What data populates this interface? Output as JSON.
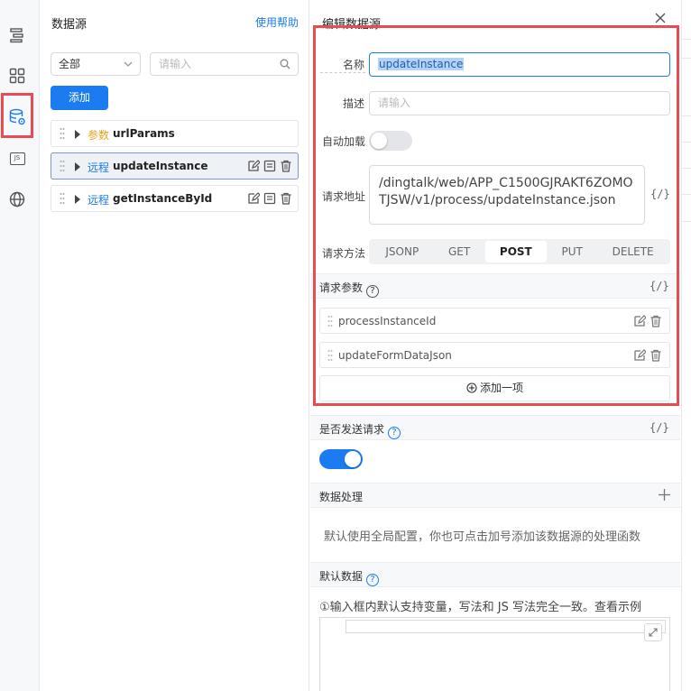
{
  "rail": {
    "icons": [
      "outline-tree-icon",
      "components-grid-icon",
      "datasource-icon",
      "js-icon",
      "globe-icon"
    ],
    "js_label": "JS"
  },
  "datasource_panel": {
    "title": "数据源",
    "help_link": "使用帮助",
    "filter_select": "全部",
    "search_placeholder": "请输入",
    "add_button": "添加",
    "items": [
      {
        "tag": "参数",
        "name": "urlParams",
        "tag_color": "#e8a020"
      },
      {
        "tag": "远程",
        "name": "updateInstance",
        "tag_color": "#1a7cf0",
        "selected": true
      },
      {
        "tag": "远程",
        "name": "getInstanceById",
        "tag_color": "#1a7cf0"
      }
    ]
  },
  "editor": {
    "title": "编辑数据源",
    "name_label": "名称",
    "name_value": "updateInstance",
    "desc_label": "描述",
    "desc_placeholder": "请输入",
    "autoload_label": "自动加载",
    "autoload_on": false,
    "url_label": "请求地址",
    "url_value": "/dingtalk/web/APP_C1500GJRAKT6ZOMOTJSW/v1/process/updateInstance.json",
    "braces": "{/}",
    "method_label": "请求方法",
    "methods": [
      "JSONP",
      "GET",
      "POST",
      "PUT",
      "DELETE"
    ],
    "method_selected": "POST",
    "params_section": "请求参数",
    "params": [
      "processInstanceId",
      "updateFormDataJson"
    ],
    "add_item": "添加一项",
    "send_section": "是否发送请求",
    "send_on": true,
    "processing_section": "数据处理",
    "processing_hint": "默认使用全局配置，你也可点击加号添加该数据源的处理函数",
    "default_data_section": "默认数据",
    "default_hint": "①输入框内默认支持变量，写法和 JS 写法完全一致。查看示例",
    "colors": {
      "accent": "#1a7cf0",
      "highlight": "#e84c52",
      "param_tag": "#e8a020"
    }
  }
}
